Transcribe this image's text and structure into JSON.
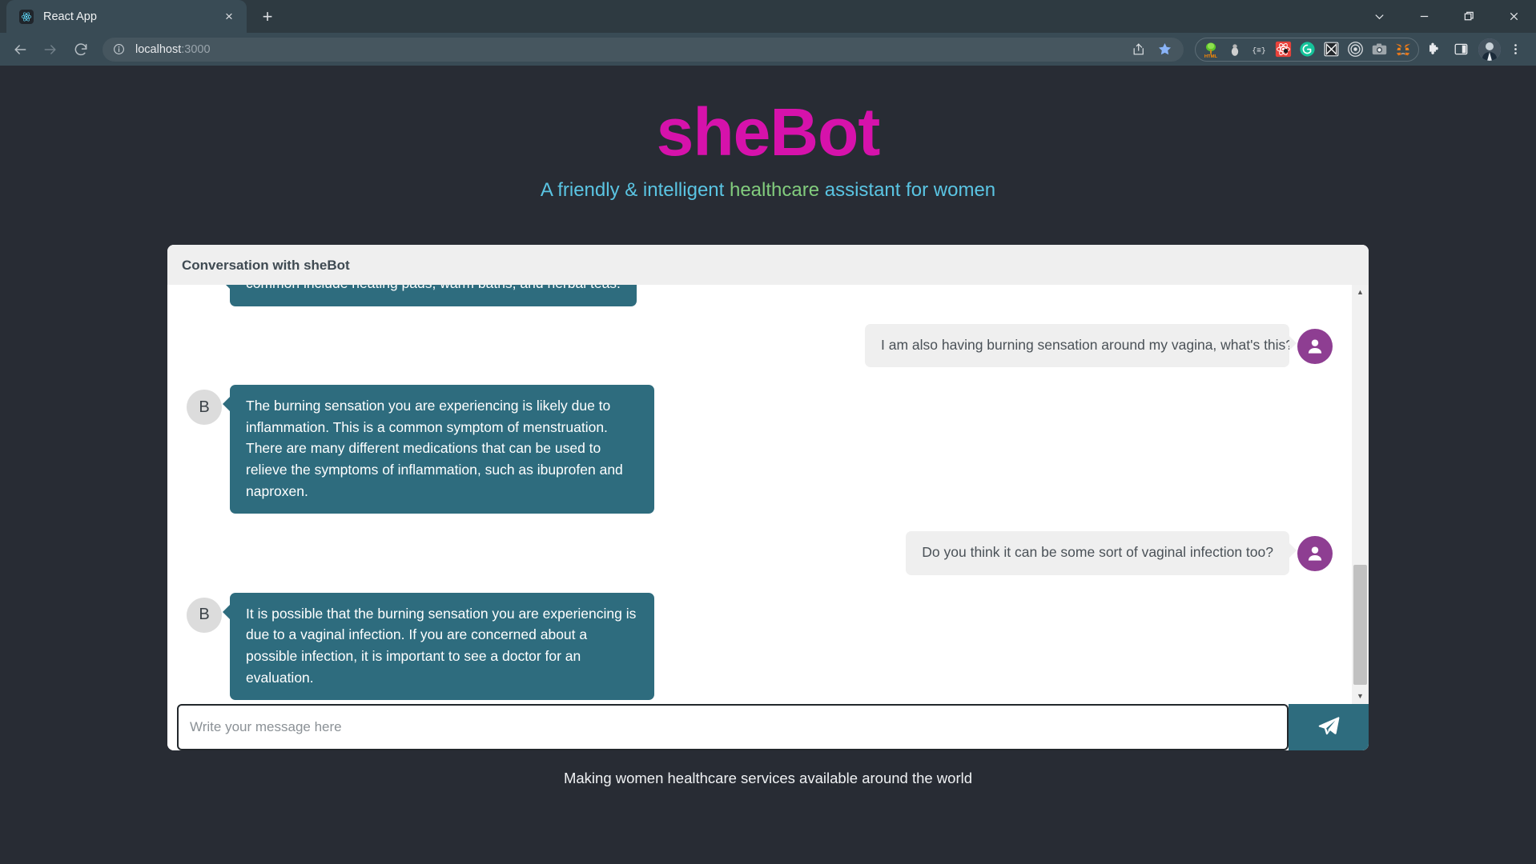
{
  "browser": {
    "tab": {
      "title": "React App",
      "favicon": "react-logo-icon",
      "close_label": "×"
    },
    "new_tab_label": "+",
    "window_controls": [
      {
        "name": "tab-search",
        "glyph": "⌄"
      },
      {
        "name": "minimize",
        "glyph": "—"
      },
      {
        "name": "maximize",
        "glyph": "❐"
      },
      {
        "name": "close",
        "glyph": "✕"
      }
    ],
    "nav": {
      "back": "←",
      "forward": "→",
      "reload": "↻"
    },
    "omnibox": {
      "host": "localhost",
      "port": ":3000",
      "info_icon": "site-info-icon",
      "share_icon": "share-icon",
      "bookmark_icon": "bookmark-star-icon"
    },
    "extensions": [
      {
        "name": "html-tree-extension",
        "label": "HTML"
      },
      {
        "name": "bug-extension",
        "label": ""
      },
      {
        "name": "json-viewer-extension",
        "label": "{≡}"
      },
      {
        "name": "react-devtools-extension",
        "label": ""
      },
      {
        "name": "grammarly-extension",
        "label": "G"
      },
      {
        "name": "ruler-extension",
        "label": ""
      },
      {
        "name": "target-extension",
        "label": ""
      },
      {
        "name": "screenshot-extension",
        "label": ""
      },
      {
        "name": "metamask-extension",
        "label": ""
      }
    ],
    "toolbar_buttons": [
      {
        "name": "extensions-puzzle",
        "glyph": "puzzle-icon"
      },
      {
        "name": "side-panel",
        "glyph": "side-panel-icon"
      },
      {
        "name": "profile-avatar",
        "glyph": "avatar-icon"
      },
      {
        "name": "chrome-menu",
        "glyph": "kebab-menu-icon"
      }
    ]
  },
  "app": {
    "title": "sheBot",
    "subtitle_before": "A friendly & intelligent ",
    "subtitle_highlight": "healthcare",
    "subtitle_after": " assistant for women",
    "footer": "Making women healthcare services available around the world",
    "accent_color": "#d612ab",
    "subtitle_color": "#61dafb",
    "highlight_color": "#8fe388",
    "bot_bubble_color": "#2e6c7e",
    "user_bubble_color": "#efefef",
    "user_avatar_color": "#8e3e92"
  },
  "chat": {
    "header": "Conversation with sheBot",
    "bot_avatar_initial": "B",
    "messages": [
      {
        "sender": "bot",
        "clipped": true,
        "text": "common include heating pads, warm baths, and herbal teas."
      },
      {
        "sender": "user",
        "text": "I am also having burning sensation around my vagina, what's this?"
      },
      {
        "sender": "bot",
        "text": "The burning sensation you are experiencing is likely due to inflammation. This is a common symptom of menstruation. There are many different medications that can be used to relieve the symptoms of inflammation, such as ibuprofen and naproxen."
      },
      {
        "sender": "user",
        "text": "Do you think it can be some sort of vaginal infection too?"
      },
      {
        "sender": "bot",
        "text": "It is possible that the burning sensation you are experiencing is due to a vaginal infection. If you are concerned about a possible infection, it is important to see a doctor for an evaluation."
      }
    ],
    "input": {
      "value": "",
      "placeholder": "Write your message here"
    },
    "send_button": {
      "label": "",
      "icon": "send-paper-plane-icon"
    },
    "scrollbar": {
      "up": "▲",
      "down": "▼"
    }
  }
}
